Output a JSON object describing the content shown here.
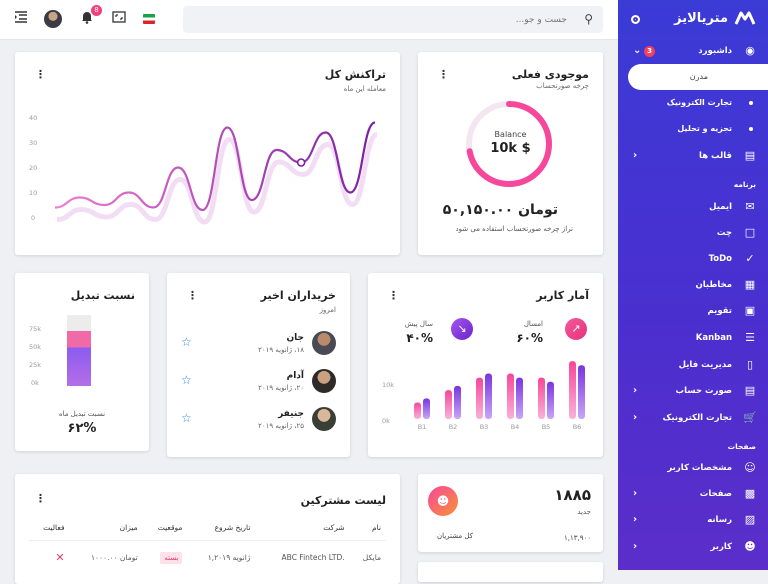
{
  "topbar": {
    "search_placeholder": "جست و جو...",
    "notification_count": "8"
  },
  "sidebar": {
    "brand": "متریالایز",
    "items": [
      {
        "label": "داشبورد",
        "icon": "palette-icon",
        "badge": "3",
        "chevron": "down"
      },
      {
        "label": "تجارت الکترونیک",
        "icon": "dot-icon",
        "sub": true
      },
      {
        "label": "تجزیه و تحلیل",
        "icon": "dot-icon",
        "sub": true
      },
      {
        "label": "قالب ها",
        "icon": "layout-icon",
        "chevron": "left"
      }
    ],
    "active_sub": "مدرن",
    "section_app": "برنامه",
    "app_items": [
      {
        "label": "ایمیل",
        "icon": "mail-icon"
      },
      {
        "label": "چت",
        "icon": "chat-icon"
      },
      {
        "label": "ToDo",
        "icon": "check-icon"
      },
      {
        "label": "مخاطبان",
        "icon": "contacts-icon"
      },
      {
        "label": "تقویم",
        "icon": "calendar-icon"
      },
      {
        "label": "Kanban",
        "icon": "kanban-icon"
      },
      {
        "label": "مدیریت فایل",
        "icon": "clipboard-icon"
      },
      {
        "label": "صورت حساب",
        "icon": "invoice-icon",
        "chevron": "left"
      },
      {
        "label": "تجارت الکترونیک",
        "icon": "cart-icon",
        "chevron": "left"
      }
    ],
    "section_pages": "صفحات",
    "page_items": [
      {
        "label": "مشخصات کاربر",
        "icon": "user-icon"
      },
      {
        "label": "صفحات",
        "icon": "pages-icon",
        "chevron": "left"
      },
      {
        "label": "رسانه",
        "icon": "image-icon",
        "chevron": "left"
      },
      {
        "label": "کاربر",
        "icon": "face-icon",
        "chevron": "left"
      }
    ]
  },
  "transactions": {
    "title": "تراکنش کل",
    "subtitle": "معامله این ماه",
    "yticks": [
      "40",
      "30",
      "20",
      "10",
      "0"
    ]
  },
  "balance": {
    "title": "موجودی فعلی",
    "subtitle": "چرخه صورتحساب",
    "ring_label": "Balance",
    "ring_value": "10k $",
    "amount": "تومان ۵۰,۱۵۰.۰۰",
    "note": "تراز چرخه صورتحساب استفاده می شود",
    "percent": 0.72
  },
  "user_stats": {
    "title": "آمار کاربر",
    "this_year_label": "امسال",
    "this_year_value": "۶۰%",
    "last_year_label": "سال پیش",
    "last_year_value": "۴۰%",
    "yticks": [
      "10k",
      "0k"
    ]
  },
  "recent_buyers": {
    "title": "خریداران اخیر",
    "subtitle": "امروز",
    "buyers": [
      {
        "name": "جان",
        "date": "۱۸، ژانویه ۲۰۱۹"
      },
      {
        "name": "آدام",
        "date": "۲۰، ژانویه ۲۰۱۹"
      },
      {
        "name": "جنیفر",
        "date": "۲۵، ژانویه ۲۰۱۹"
      }
    ]
  },
  "conversion": {
    "title": "نسبت تبدیل",
    "yticks": [
      "75k",
      "50k",
      "25k",
      "0k"
    ],
    "caption": "نسبت تبدیل ماه",
    "value": "۶۲%",
    "fill": 0.62
  },
  "subscribers": {
    "title": "لیست مشترکین",
    "columns": [
      "نام",
      "شرکت",
      "تاریخ شروع",
      "موقعیت",
      "میزان",
      "فعالیت"
    ],
    "rows": [
      {
        "name": "مایکل",
        "company": "ABC Fintech LTD.",
        "date": "ژانویه ۱,۲۰۱۹",
        "status": "بسته",
        "amount": "تومان ۱۰۰۰.۰۰"
      }
    ]
  },
  "customers": {
    "value": "۱۸۸۵",
    "label": "جدید",
    "total_label": "کل مشتریان",
    "total_value": "۱,۱۳,۹۰۰"
  },
  "chart_data": [
    {
      "type": "line",
      "title": "تراکنش کل",
      "ylim": [
        0,
        40
      ],
      "x": [
        0,
        1,
        2,
        3,
        4,
        5,
        6,
        7,
        8,
        9,
        10,
        11,
        12,
        13
      ],
      "series": [
        {
          "values": [
            5,
            9,
            6,
            11,
            5,
            21,
            4,
            37,
            8,
            28,
            23,
            35,
            11,
            39
          ]
        }
      ]
    },
    {
      "type": "bar",
      "title": "آمار کاربر",
      "categories": [
        "B1",
        "B2",
        "B3",
        "B4",
        "B5",
        "B6"
      ],
      "ylim": [
        0,
        12
      ],
      "series": [
        {
          "name": "امسال",
          "values": [
            4,
            7,
            10,
            11,
            10,
            14
          ]
        },
        {
          "name": "سال پیش",
          "values": [
            5,
            8,
            11,
            10,
            9,
            13
          ]
        }
      ]
    }
  ]
}
